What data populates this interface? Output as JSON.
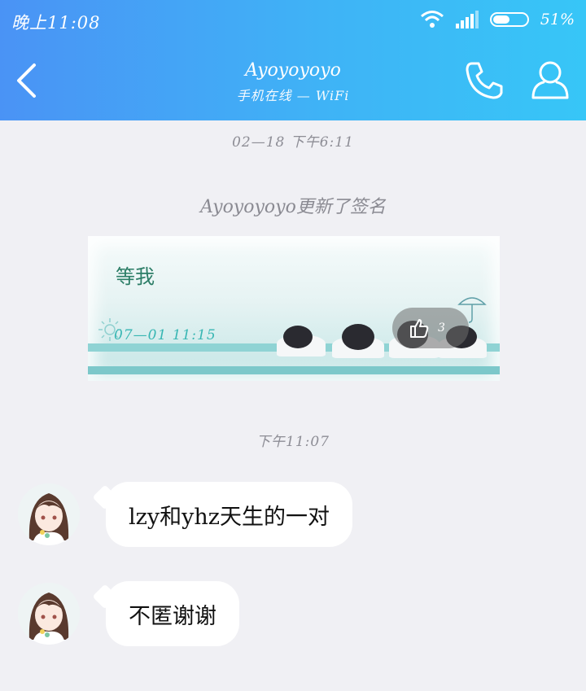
{
  "status_bar": {
    "time": "晚上11:08",
    "battery": "51%",
    "battery_level": 0.51
  },
  "header": {
    "title": "Ayoyoyoyo",
    "subtitle": "手机在线 — WiFi"
  },
  "chat": {
    "timestamp_1": "02—18 下午6:11",
    "signature_notice": "Ayoyoyoyo更新了签名",
    "signature_card": {
      "text": "等我",
      "date": "07—01 11:15",
      "likes": "3"
    },
    "timestamp_2": "下午11:07",
    "messages": [
      {
        "text": "lzy和yhz天生的一对"
      },
      {
        "text": "不匿谢谢"
      }
    ]
  }
}
